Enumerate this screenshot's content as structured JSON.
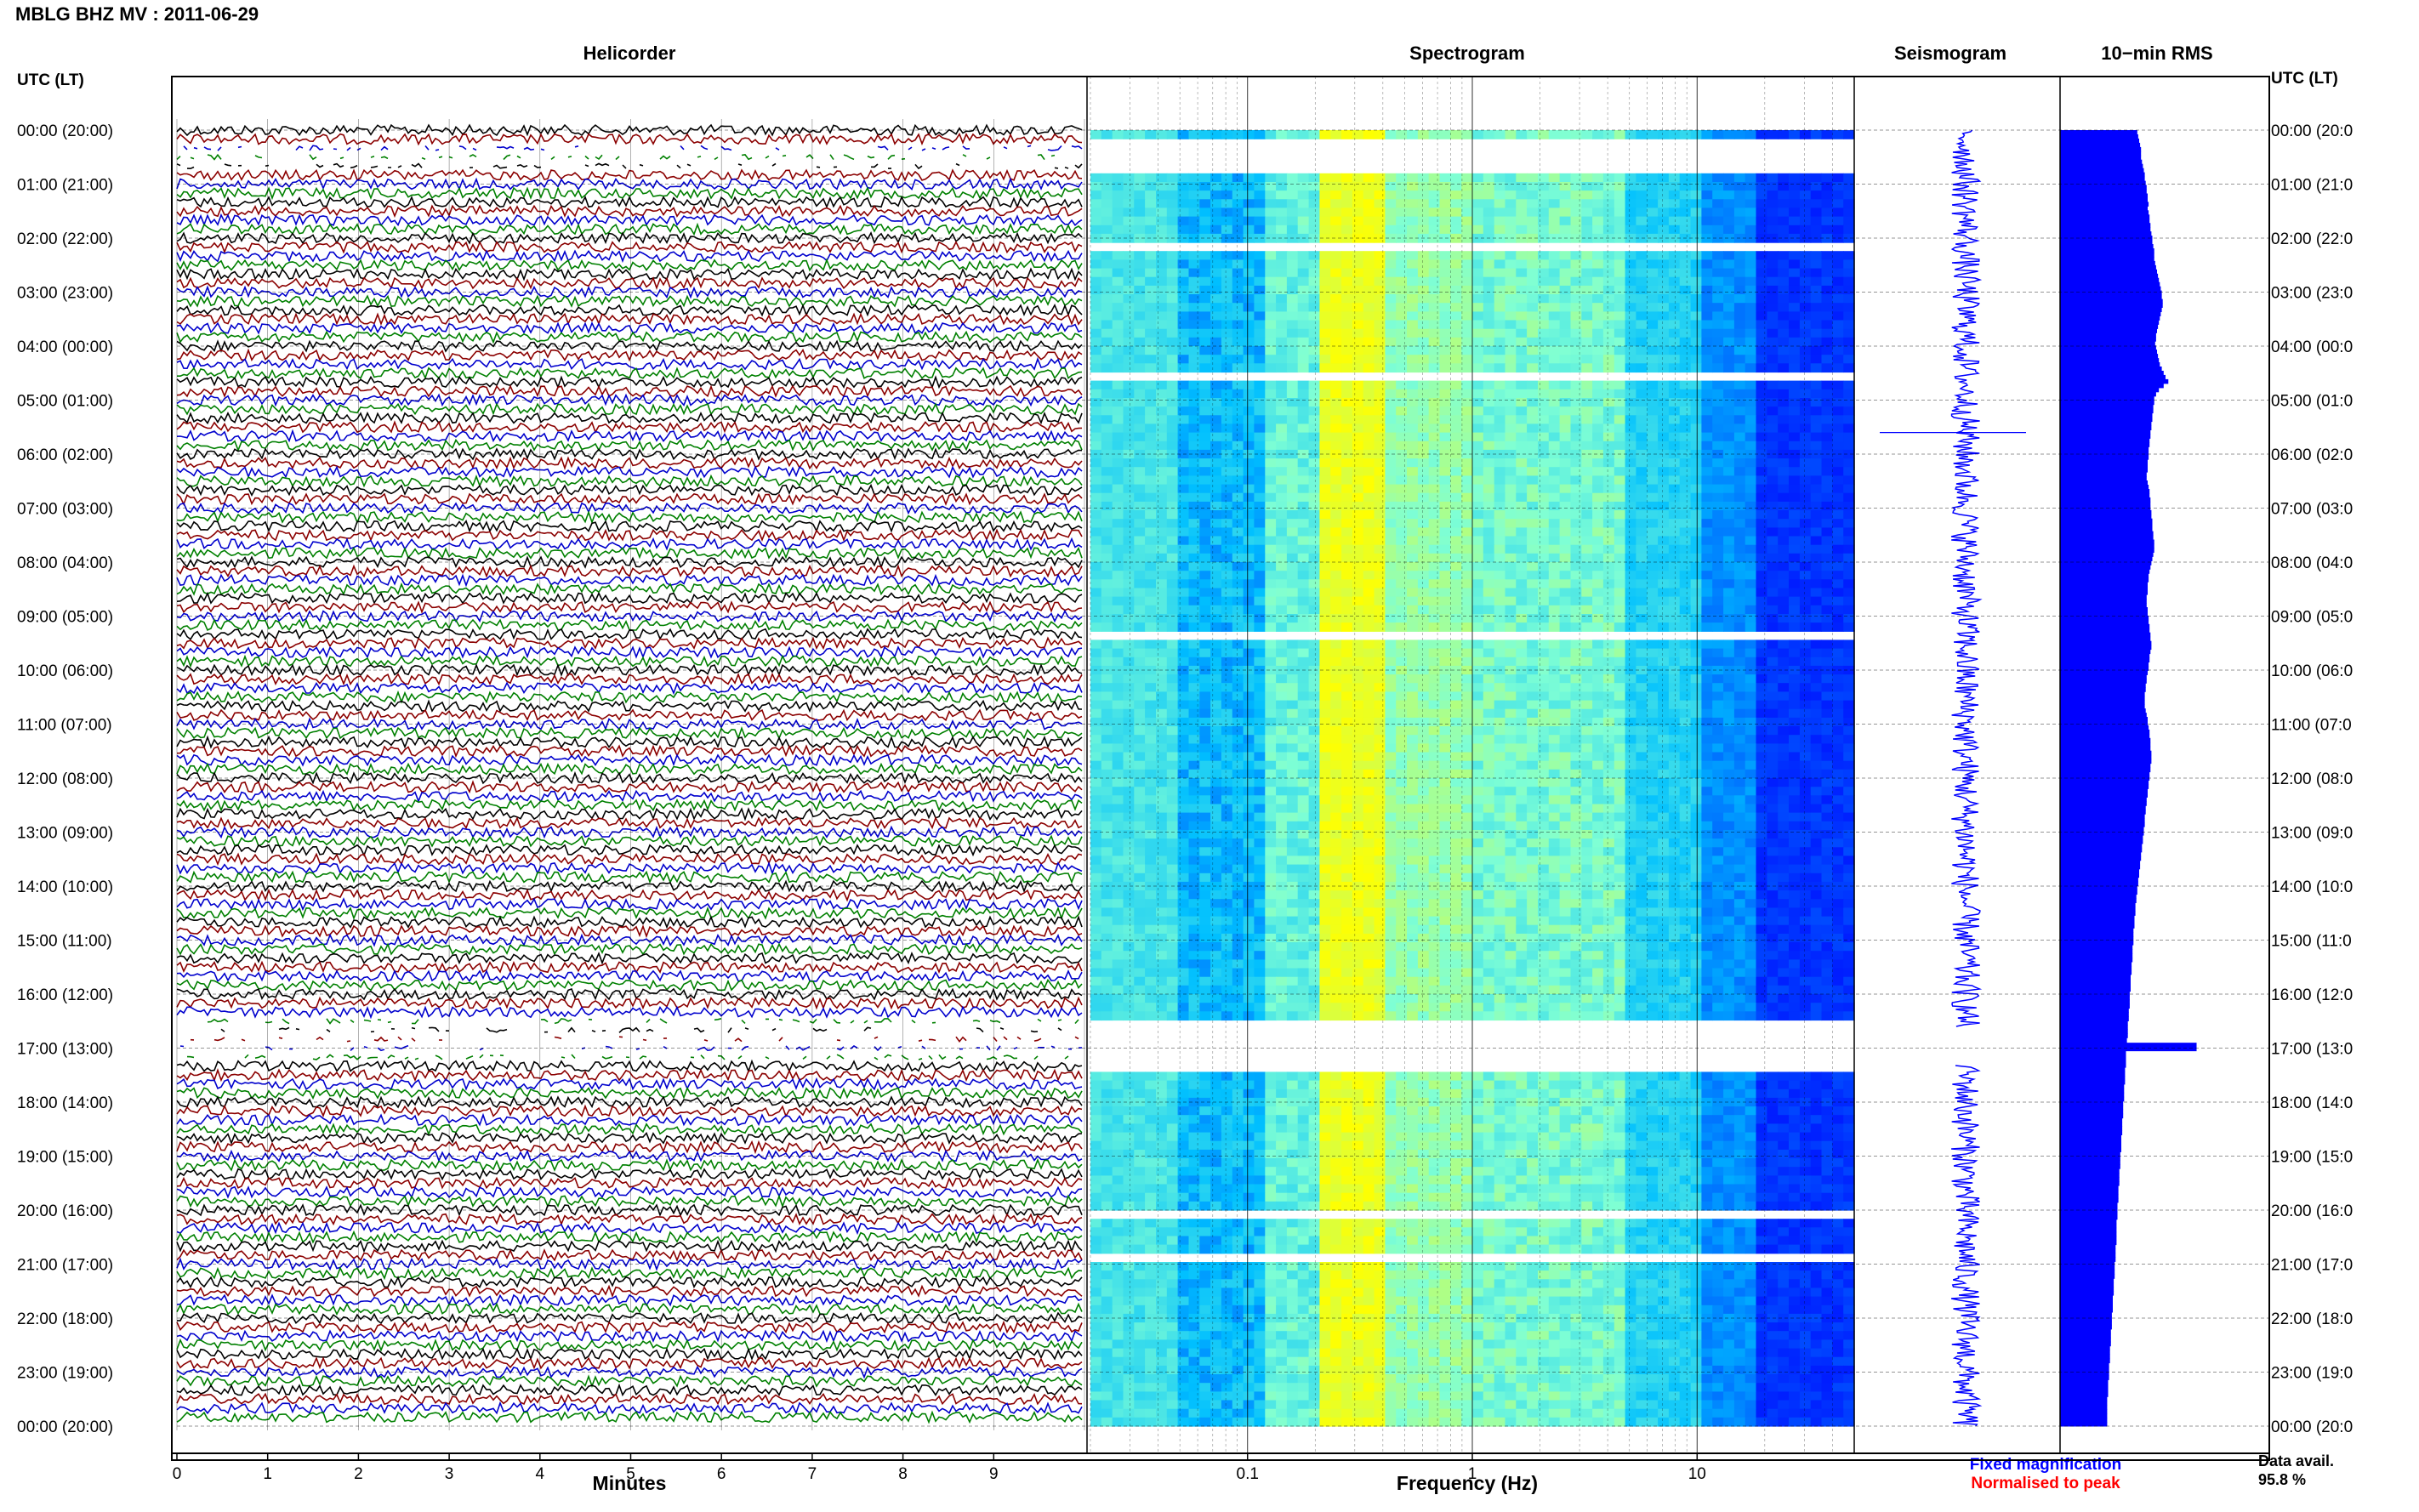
{
  "station_title": "MBLG BHZ MV : 2011-06-29",
  "utc_header_left": "UTC (LT)",
  "utc_header_right": "UTC (LT)",
  "panels": {
    "helicorder": "Helicorder",
    "spectrogram": "Spectrogram",
    "seismogram": "Seismogram",
    "rms": "10−min RMS"
  },
  "time_labels_left": [
    "00:00 (20:00)",
    "01:00 (21:00)",
    "02:00 (22:00)",
    "03:00 (23:00)",
    "04:00 (00:00)",
    "05:00 (01:00)",
    "06:00 (02:00)",
    "07:00 (03:00)",
    "08:00 (04:00)",
    "09:00 (05:00)",
    "10:00 (06:00)",
    "11:00 (07:00)",
    "12:00 (08:00)",
    "13:00 (09:00)",
    "14:00 (10:00)",
    "15:00 (11:00)",
    "16:00 (12:00)",
    "17:00 (13:00)",
    "18:00 (14:00)",
    "19:00 (15:00)",
    "20:00 (16:00)",
    "21:00 (17:00)",
    "22:00 (18:00)",
    "23:00 (19:00)",
    "00:00 (20:00)"
  ],
  "time_labels_right": [
    "00:00 (20:0",
    "01:00 (21:0",
    "02:00 (22:0",
    "03:00 (23:0",
    "04:00 (00:0",
    "05:00 (01:0",
    "06:00 (02:0",
    "07:00 (03:0",
    "08:00 (04:0",
    "09:00 (05:0",
    "10:00 (06:0",
    "11:00 (07:0",
    "12:00 (08:0",
    "13:00 (09:0",
    "14:00 (10:0",
    "15:00 (11:0",
    "16:00 (12:0",
    "17:00 (13:0",
    "18:00 (14:0",
    "19:00 (15:0",
    "20:00 (16:0",
    "21:00 (17:0",
    "22:00 (18:0",
    "23:00 (19:0",
    "00:00 (20:0"
  ],
  "helicorder_axis": {
    "ticks": [
      "0",
      "1",
      "2",
      "3",
      "4",
      "5",
      "6",
      "7",
      "8",
      "9"
    ],
    "label": "Minutes"
  },
  "spectrogram_axis": {
    "ticks": [
      "0.1",
      "1",
      "10"
    ],
    "label": "Frequency (Hz)"
  },
  "legend": {
    "fixed": "Fixed magnification",
    "normalised": "Normalised to peak",
    "fixed_color": "#0000ff",
    "normalised_color": "#ff0000"
  },
  "data_avail": {
    "label": "Data avail.",
    "value": "95.8 %"
  },
  "trace_colors": [
    "#000000",
    "#8b0000",
    "#0000cd",
    "#008000"
  ],
  "chart_data": [
    {
      "type": "line",
      "title": "Helicorder",
      "xlabel": "Minutes",
      "xlim": [
        0,
        10
      ],
      "y_hours_utc": [
        0,
        24
      ],
      "line_interval_min": 10,
      "series_colors_cycle": [
        "black",
        "dark red",
        "blue",
        "green"
      ],
      "gaps": [
        {
          "start_hour": 0.25,
          "end_hour": 0.75,
          "note": "intermittent"
        },
        {
          "start_hour": 16.5,
          "end_hour": 17.25,
          "note": "intermittent"
        }
      ]
    },
    {
      "type": "heatmap",
      "title": "Spectrogram",
      "xlabel": "Frequency (Hz)",
      "xscale": "log",
      "xlim": [
        0.02,
        50
      ],
      "y_hours_utc": [
        0,
        24
      ],
      "colormap": [
        "#0000ff",
        "#00bfff",
        "#7fffd4",
        "#ffff00"
      ],
      "dominant_band_hz": [
        0.2,
        0.4
      ],
      "gaps_hours": [
        [
          0.3,
          0.75
        ],
        [
          2.15,
          2.2
        ],
        [
          4.5,
          4.55
        ],
        [
          16.5,
          17.3
        ],
        [
          20.1,
          20.15
        ],
        [
          20.8,
          20.85
        ],
        [
          9.3,
          9.35
        ]
      ]
    },
    {
      "type": "line",
      "title": "Seismogram",
      "y_hours_utc": [
        0,
        24
      ],
      "gaps_hours": [
        [
          16.6,
          17.3
        ]
      ]
    },
    {
      "type": "bar",
      "title": "10−min RMS",
      "orientation": "horizontal",
      "interval_min": 10,
      "y_hours_utc": [
        0,
        24
      ],
      "relative_values": [
        0.82,
        0.83,
        0.84,
        0.85,
        0.86,
        0.86,
        0.86,
        0.87,
        0.88,
        0.89,
        0.9,
        0.9,
        0.91,
        0.92,
        0.92,
        0.93,
        0.93,
        0.94,
        0.93,
        0.94,
        0.95,
        0.95,
        0.96,
        0.96,
        0.97,
        0.98,
        0.98,
        0.99,
        1.0,
        1.0,
        1.0,
        1.01,
        1.02,
        1.03,
        1.04,
        1.05,
        1.06,
        1.07,
        1.08,
        1.08,
        1.09,
        1.09,
        1.08,
        1.07,
        1.06,
        1.05,
        1.04,
        1.03,
        1.02,
        1.02,
        1.01,
        1.02,
        1.03,
        1.04,
        1.05,
        1.06,
        1.08,
        1.1,
        1.12,
        1.15,
        1.1,
        1.05,
        1.02,
        1.0,
        1.0,
        0.99,
        0.99,
        0.98,
        0.98,
        0.97,
        0.97,
        0.96,
        0.96,
        0.95,
        0.95,
        0.94,
        0.94,
        0.94,
        0.93,
        0.93,
        0.93,
        0.92,
        0.92,
        0.93,
        0.94,
        0.95,
        0.95,
        0.96,
        0.96,
        0.96,
        0.97,
        0.97,
        0.98,
        0.98,
        0.98,
        0.99,
        0.99,
        1.0,
        1.0,
        1.0,
        0.99,
        0.98,
        0.97,
        0.96,
        0.95,
        0.94,
        0.94,
        0.93,
        0.93,
        0.93,
        0.92,
        0.92,
        0.92,
        0.93,
        0.93,
        0.94,
        0.94,
        0.95,
        0.95,
        0.96,
        0.96,
        0.97,
        0.97,
        0.96,
        0.95,
        0.95,
        0.94,
        0.94,
        0.93,
        0.92,
        0.92,
        0.91,
        0.91,
        0.9,
        0.9,
        0.9,
        0.9,
        0.91,
        0.92,
        0.93,
        0.93,
        0.94,
        0.95,
        0.95,
        0.96,
        0.96,
        0.96,
        0.97,
        0.97,
        0.97,
        0.96,
        0.96,
        0.95,
        0.95,
        0.94,
        0.94,
        0.93,
        0.93,
        0.92,
        0.92,
        0.91,
        0.91,
        0.9,
        0.9,
        0.9,
        0.89,
        0.89,
        0.88,
        0.88,
        0.87,
        0.87,
        0.86,
        0.86,
        0.85,
        0.85,
        0.84,
        0.84,
        0.83,
        0.83,
        0.82,
        0.82,
        0.81,
        0.81,
        0.8,
        0.8,
        0.8,
        0.79,
        0.79,
        0.79,
        0.78,
        0.78,
        0.78,
        0.78,
        0.77,
        0.77,
        0.77,
        0.77,
        0.76,
        0.76,
        0.76,
        0.75,
        0.75,
        0.75,
        0.75,
        0.74,
        0.74,
        0.74,
        0.74,
        0.73,
        0.73,
        0.73,
        0.72,
        0.72,
        0.72,
        0.72,
        0.71,
        0.71,
        0.71,
        0.7,
        0.7,
        0.7,
        0.7,
        0.69,
        0.69,
        0.69,
        0.69,
        0.68,
        0.68,
        0.68,
        0.68,
        0.67,
        0.67,
        0.67,
        0.67,
        0.66,
        0.66,
        0.66,
        0.66,
        0.65,
        0.65,
        0.65,
        0.65,
        0.64,
        0.64,
        0.64,
        0.64,
        0.63,
        0.63,
        0.63,
        0.63,
        0.62,
        0.62,
        0.62,
        0.62,
        0.61,
        0.61,
        0.61,
        0.61,
        0.6,
        0.6,
        0.6,
        0.6,
        0.6,
        0.6,
        0.59,
        0.59,
        0.59,
        0.59,
        0.58,
        0.58,
        0.58,
        0.58,
        0.57,
        0.57,
        0.57,
        0.57,
        0.56,
        0.56,
        0.56,
        0.56,
        0.55,
        0.55,
        0.55,
        0.55,
        0.54,
        0.54,
        0.54,
        0.54,
        0.53,
        0.53,
        0.53,
        0.53,
        0.52,
        0.52,
        0.52,
        0.52,
        0.51,
        0.51,
        0.51,
        0.51,
        0.5,
        0.5,
        0.5,
        0.5,
        0.5,
        0.5,
        0.5
      ],
      "spike_at_hour": 16.9,
      "color": "#0000ff"
    }
  ]
}
